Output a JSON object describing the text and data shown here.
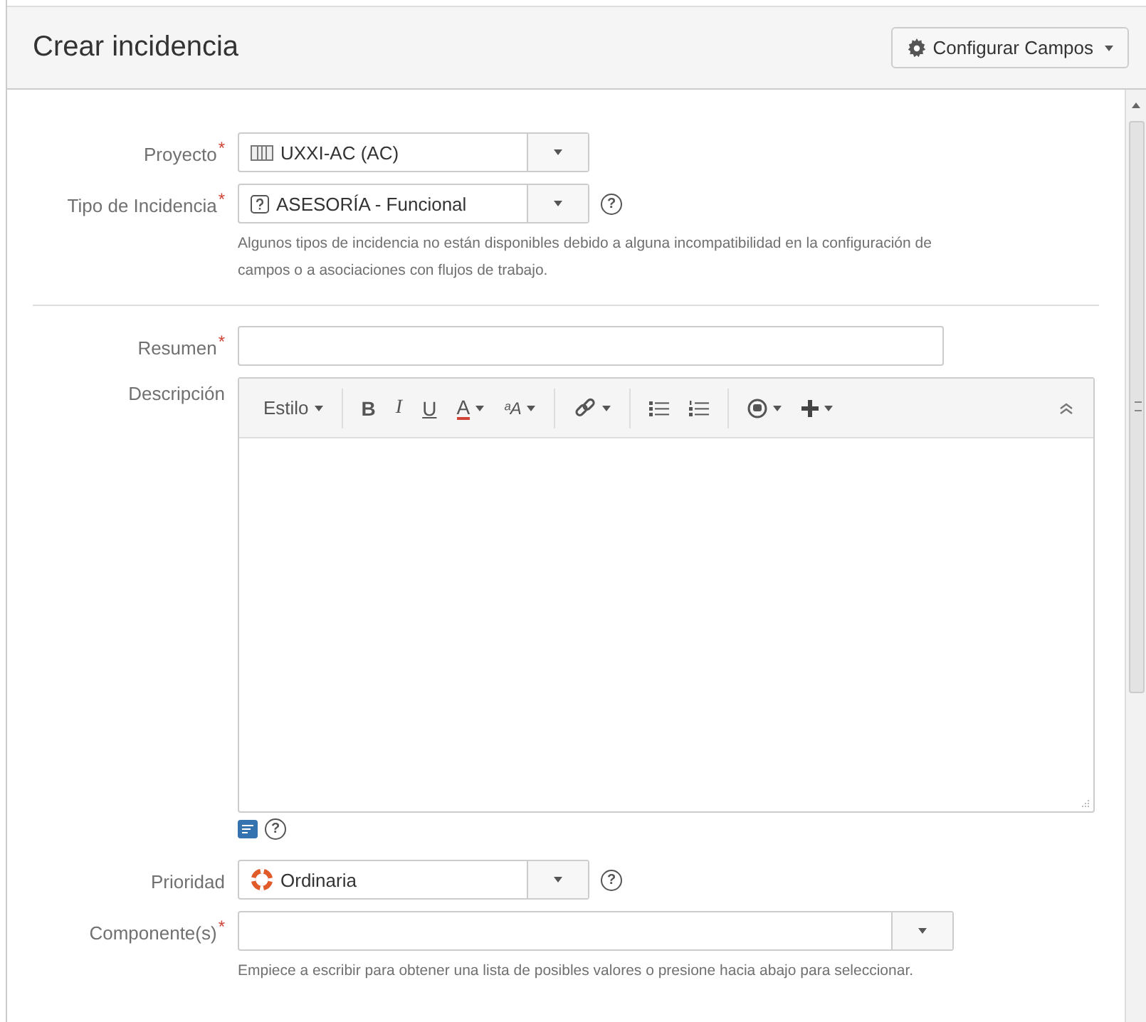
{
  "dialog": {
    "title": "Crear incidencia",
    "configure_button": "Configurar Campos"
  },
  "fields": [
    {
      "kind": "project-select",
      "label": "Proyecto",
      "required_mark": "*",
      "value": "UXXI-AC (AC)"
    },
    {
      "kind": "type-select",
      "label": "Tipo de Incidencia",
      "required_mark": "*",
      "value": "ASESORÍA - Funcional",
      "help": "?",
      "hint": "Algunos tipos de incidencia no están disponibles debido a alguna incompatibilidad en la configuración de campos o a asociaciones con flujos de trabajo.",
      "divider_after": true
    },
    {
      "kind": "text",
      "label": "Resumen",
      "required_mark": "*"
    },
    {
      "kind": "editor",
      "label": "Descripción",
      "help": "?",
      "toolbar": [
        [
          {
            "kind": "text",
            "text": "Estilo",
            "caret": true
          }
        ],
        [
          {
            "kind": "bold",
            "text": "B"
          },
          {
            "kind": "italic",
            "text": "I"
          },
          {
            "kind": "underline",
            "text": "U"
          },
          {
            "kind": "color",
            "text": "A",
            "caret": true
          },
          {
            "kind": "clear-format",
            "text": "ᵃA",
            "caret": true
          }
        ],
        [
          {
            "kind": "link",
            "caret": true
          }
        ],
        [
          {
            "kind": "bullets"
          },
          {
            "kind": "numbers"
          }
        ],
        [
          {
            "kind": "emoji",
            "caret": true
          },
          {
            "kind": "plus",
            "caret": true
          }
        ]
      ]
    },
    {
      "kind": "priority-select",
      "label": "Prioridad",
      "value": "Ordinaria",
      "help": "?"
    },
    {
      "kind": "multi-select",
      "label": "Componente(s)",
      "required_mark": "*",
      "hint": "Empiece a escribir para obtener una lista de posibles valores o presione hacia abajo para seleccionar."
    }
  ]
}
